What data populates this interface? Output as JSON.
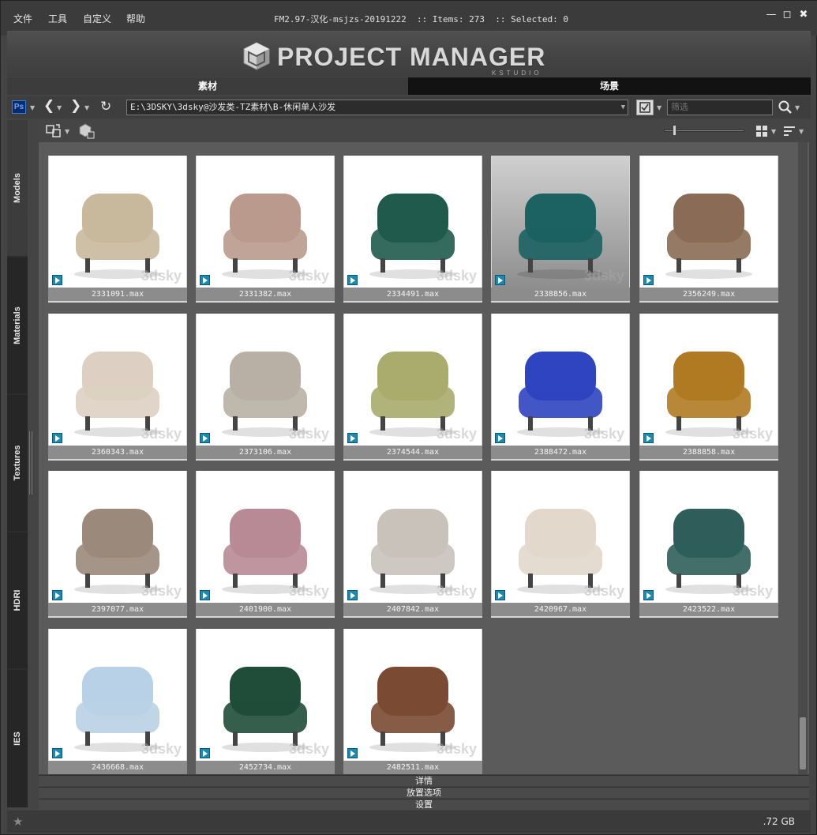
{
  "menu": [
    "文件",
    "工具",
    "自定义",
    "帮助"
  ],
  "titlebar": "FM2.97-汉化-msjzs-20191222  :: Items: 273  :: Selected: 0",
  "logo": {
    "main": "PROJECT MANAGER",
    "sub": "KSTUDIO"
  },
  "tabs": {
    "active": "素材",
    "other": "场景"
  },
  "toolbar": {
    "ps_label": "Ps",
    "path": "E:\\3DSKY\\3dsky@沙发类-TZ素材\\B-休闲单人沙发",
    "filter_placeholder": "筛选"
  },
  "rail": [
    "Models",
    "Materials",
    "Textures",
    "HDRI",
    "IES"
  ],
  "items": [
    {
      "file": "2331091.max",
      "bg": "white",
      "watermark": "3dsky"
    },
    {
      "file": "2331382.max",
      "bg": "white",
      "watermark": "3dsky"
    },
    {
      "file": "2334491.max",
      "bg": "white",
      "watermark": "3dsky"
    },
    {
      "file": "2338856.max",
      "bg": "grey",
      "watermark": "3dsky"
    },
    {
      "file": "2356249.max",
      "bg": "white",
      "watermark": ""
    },
    {
      "file": "2360343.max",
      "bg": "white",
      "watermark": "3dsky"
    },
    {
      "file": "2373106.max",
      "bg": "white",
      "watermark": "3dsky"
    },
    {
      "file": "2374544.max",
      "bg": "white",
      "watermark": "3dsky"
    },
    {
      "file": "2388472.max",
      "bg": "white",
      "watermark": "3dsky"
    },
    {
      "file": "2388858.max",
      "bg": "white",
      "watermark": "3dsky"
    },
    {
      "file": "2397077.max",
      "bg": "white",
      "watermark": "3dsky"
    },
    {
      "file": "2401900.max",
      "bg": "white",
      "watermark": "3dsky"
    },
    {
      "file": "2407842.max",
      "bg": "white",
      "watermark": "3dsky"
    },
    {
      "file": "2420967.max",
      "bg": "white",
      "watermark": "3dsky"
    },
    {
      "file": "2423522.max",
      "bg": "white",
      "watermark": "3dsky"
    },
    {
      "file": "2436668.max",
      "bg": "white",
      "watermark": "3dsky"
    },
    {
      "file": "2452734.max",
      "bg": "white",
      "watermark": "3dsky"
    },
    {
      "file": "2482511.max",
      "bg": "white",
      "watermark": "3dsky"
    }
  ],
  "panels": [
    "详情",
    "放置选项",
    "设置"
  ],
  "status": {
    "size": ".72 GB"
  },
  "colors": {
    "accent_ps": "#3d7bd8",
    "max_badge": "#1a8ab0",
    "window_bg": "#444444",
    "content_bg": "#5b5b5b"
  }
}
